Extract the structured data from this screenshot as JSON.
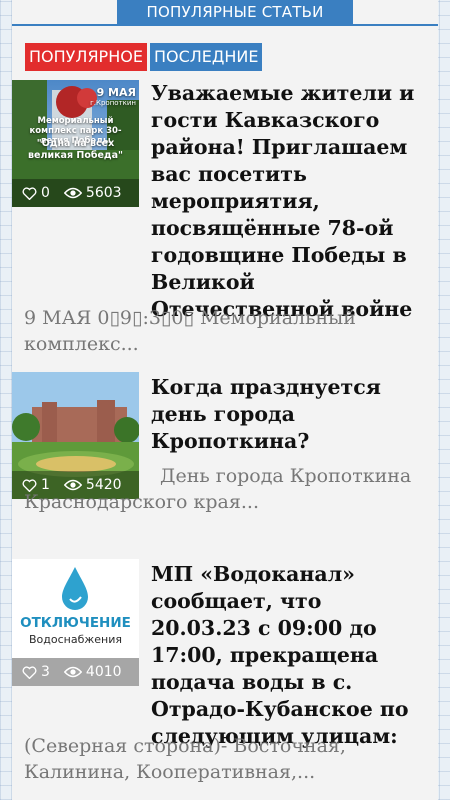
{
  "widget": {
    "header": "ПОПУЛЯРНЫЕ СТАТЬИ"
  },
  "tabs": [
    {
      "label": "ПОПУЛЯРНОЕ"
    },
    {
      "label": "ПОСЛЕДНИЕ"
    }
  ],
  "articles": [
    {
      "title": "Уважаемые жители и гости Кавказского района! Приглашаем вас посетить мероприятия, посвящённые 78-ой годовщине Победы в Великой Отечественной войне",
      "excerpt": "9 МАЯ 0▯9▯:3▯0▯ Мемориальный комплекс...",
      "likes": "0",
      "views": "5603",
      "image_text": {
        "date": "9 МАЯ",
        "city": "г.Кропоткин",
        "line1": "Мемориальный комплекс парк 30-летия Победы",
        "line2": "\"Одна на всех великая Победа\""
      }
    },
    {
      "title": "Когда празднуется день города Кропоткина?",
      "excerpt": "День города Кропоткина Краснодарского края...",
      "likes": "1",
      "views": "5420"
    },
    {
      "title": "МП «Водоканал» сообщает, что 20.03.23 с 09:00 до 17:00, прекращена подача воды в с. Отрадо-Кубанское по следующим улицам:",
      "excerpt": "(Северная сторона)- Восточная, Калинина, Кооперативная,...",
      "likes": "3",
      "views": "4010",
      "image_text": {
        "line1": "ОТКЛЮЧЕНИЕ",
        "line2": "Водоснабжения"
      }
    }
  ],
  "colors": {
    "header_blue": "#3a7fc1",
    "popular_red": "#e22d2d"
  }
}
